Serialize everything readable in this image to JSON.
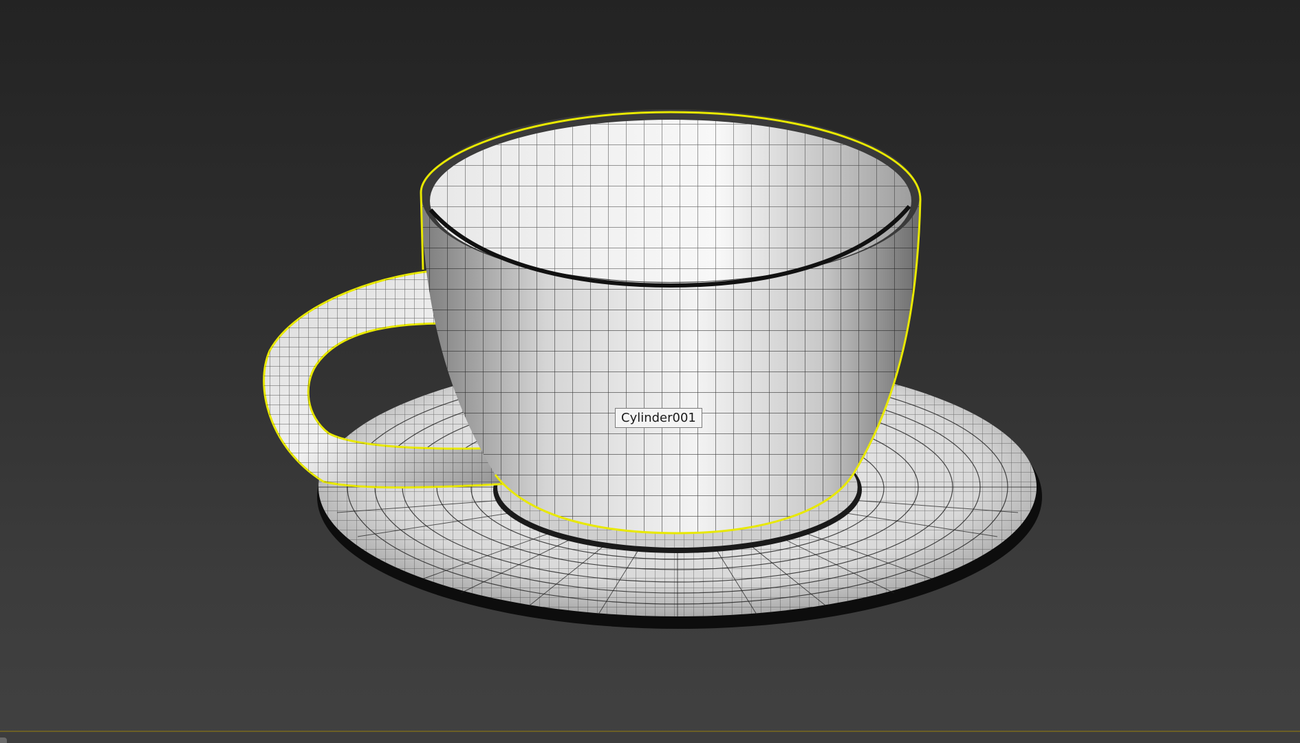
{
  "viewport": {
    "selected_object_label": "Cylinder001",
    "selection_color": "#e8e800",
    "background_top": "#232323",
    "background_bottom": "#414141"
  },
  "icons": {
    "cup": "teacup-mesh",
    "saucer": "saucer-mesh"
  }
}
